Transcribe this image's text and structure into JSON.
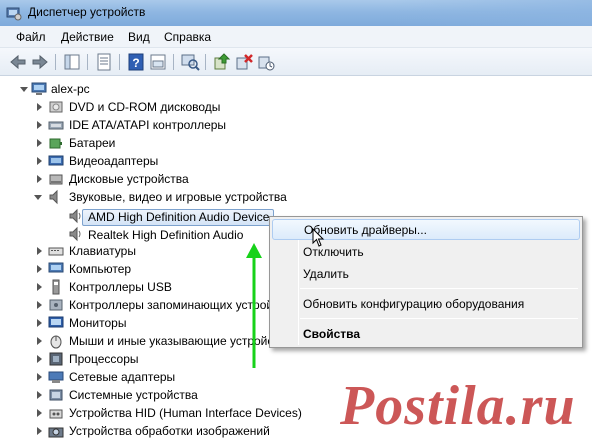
{
  "window": {
    "title": "Диспетчер устройств",
    "accent": "#8fb7e2"
  },
  "menubar": {
    "items": [
      "Файл",
      "Действие",
      "Вид",
      "Справка"
    ]
  },
  "toolbar": {
    "icons": [
      "back-arrow-icon",
      "forward-arrow-icon",
      "show-hide-tree-icon",
      "properties-icon",
      "help-icon",
      "action-pane-icon",
      "scan-hardware-icon",
      "update-driver-icon",
      "uninstall-icon",
      "disable-icon"
    ]
  },
  "tree": {
    "root": "alex-pc",
    "categories": [
      "DVD и CD-ROM дисководы",
      "IDE ATA/ATAPI контроллеры",
      "Батареи",
      "Видеоадаптеры",
      "Дисковые устройства",
      "Звуковые, видео и игровые устройства",
      "Клавиатуры",
      "Компьютер",
      "Контроллеры USB",
      "Контроллеры запоминающих устройств",
      "Мониторы",
      "Мыши и иные указывающие устройства",
      "Процессоры",
      "Сетевые адаптеры",
      "Системные устройства",
      "Устройства HID (Human Interface Devices)",
      "Устройства обработки изображений"
    ],
    "sound_devices": [
      "AMD High Definition Audio Device",
      "Realtek High Definition Audio"
    ]
  },
  "context_menu": {
    "update_driver": "Обновить драйверы...",
    "disable": "Отключить",
    "uninstall": "Удалить",
    "scan": "Обновить конфигурацию оборудования",
    "properties": "Свойства"
  },
  "watermark": "Postila.ru"
}
